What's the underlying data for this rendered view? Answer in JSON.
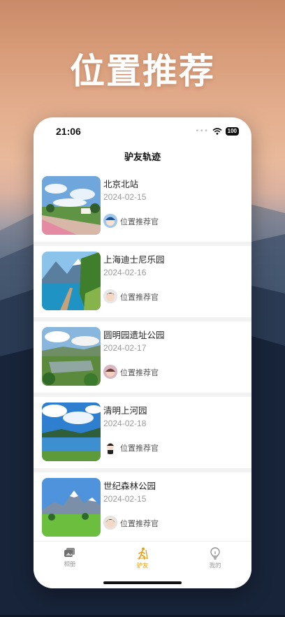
{
  "headline": "位置推荐",
  "status_bar": {
    "time": "21:06",
    "battery": "100"
  },
  "nav": {
    "title": "驴友轨迹"
  },
  "items": [
    {
      "name": "北京北站",
      "date": "2024-02-15",
      "author": "位置推荐官"
    },
    {
      "name": "上海迪士尼乐园",
      "date": "2024-02-16",
      "author": "位置推荐官"
    },
    {
      "name": "圆明园遗址公园",
      "date": "2024-02-17",
      "author": "位置推荐官"
    },
    {
      "name": "清明上河园",
      "date": "2024-02-18",
      "author": "位置推荐官"
    },
    {
      "name": "世纪森林公园",
      "date": "2024-02-15",
      "author": "位置推荐官"
    }
  ],
  "tabs": [
    {
      "label": "相册",
      "icon": "album-icon"
    },
    {
      "label": "驴友",
      "icon": "hiker-icon"
    },
    {
      "label": "我的",
      "icon": "bulb-icon"
    }
  ],
  "colors": {
    "accent": "#e6a21a",
    "inactive": "#999999"
  }
}
